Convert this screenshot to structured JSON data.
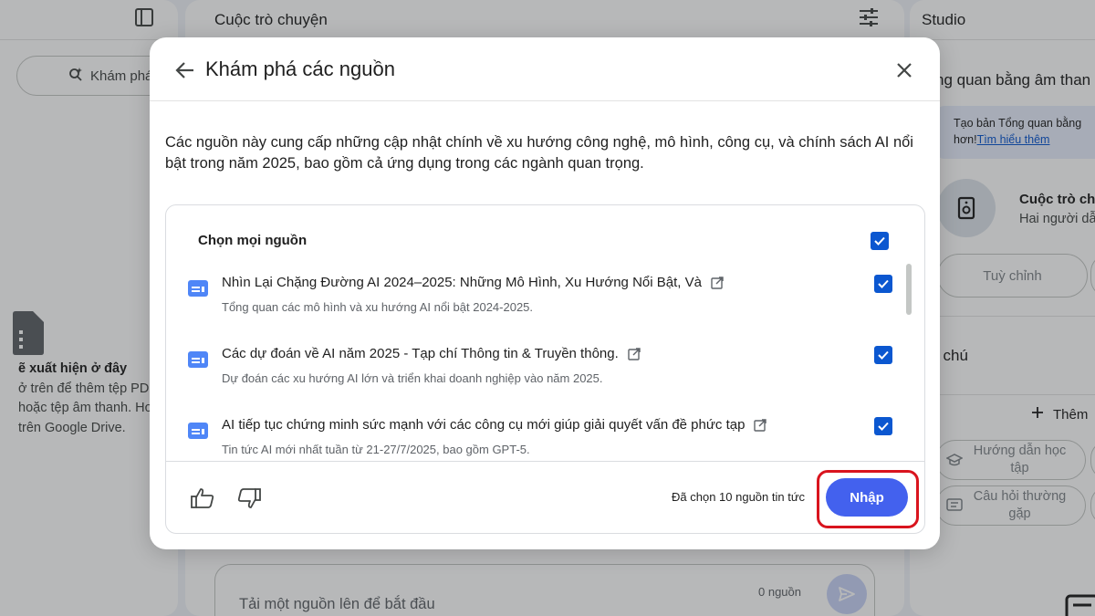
{
  "app": {
    "center_panel_title": "Cuộc trò chuyện",
    "right_panel_title": "Studio",
    "discover_button": "Khám phá",
    "left_empty": {
      "title": "ẽ xuất hiện ở đây",
      "line1": "ở trên để thêm tệp PDF,",
      "line2": "hoặc tệp âm thanh. Hoặ",
      "line3": "trên Google Drive."
    },
    "composer": {
      "placeholder": "Tải một nguồn lên để bắt đầu",
      "source_count": "0 nguồn"
    },
    "studio": {
      "audio_overview_title": "ng quan bằng âm than",
      "banner_text": "Tạo bản Tổng quan bằng",
      "banner_text2": "hơn!",
      "banner_link": "Tìm hiểu thêm",
      "audio_item_title": "Cuộc trò chuyện",
      "audio_item_subtitle": "Hai người dẫn dắ",
      "customize_button": "Tuỳ chỉnh",
      "notes_title": "i chú",
      "add_note_button": "Thêm",
      "chip_study_guide": "Hướng dẫn học tập",
      "chip_faq": "Câu hỏi thường gặp"
    }
  },
  "dialog": {
    "title": "Khám phá các nguồn",
    "description": "Các nguồn này cung cấp những cập nhật chính về xu hướng công nghệ, mô hình, công cụ, và chính sách AI nổi bật trong năm 2025, bao gồm cả ứng dụng trong các ngành quan trọng.",
    "select_all_label": "Chọn mọi nguồn",
    "sources": [
      {
        "title": "Nhìn Lại Chặng Đường AI 2024–2025: Những Mô Hình, Xu Hướng Nổi Bật, Và",
        "subtitle": "Tổng quan các mô hình và xu hướng AI nổi bật 2024-2025.",
        "checked": true
      },
      {
        "title": "Các dự đoán về AI năm 2025 - Tạp chí Thông tin & Truyền thông.",
        "subtitle": "Dự đoán các xu hướng AI lớn và triển khai doanh nghiệp vào năm 2025.",
        "checked": true
      },
      {
        "title": "AI tiếp tục chứng minh sức mạnh với các công cụ mới giúp giải quyết vấn đề phức tạp",
        "subtitle": "Tin tức AI mới nhất tuần từ 21-27/7/2025, bao gồm GPT-5.",
        "checked": true
      }
    ],
    "selected_count_text": "Đã chọn 10 nguồn tin tức",
    "import_button": "Nhập"
  },
  "colors": {
    "accent": "#0b57d0",
    "import_button": "#4361ee",
    "highlight": "#d9141e"
  }
}
